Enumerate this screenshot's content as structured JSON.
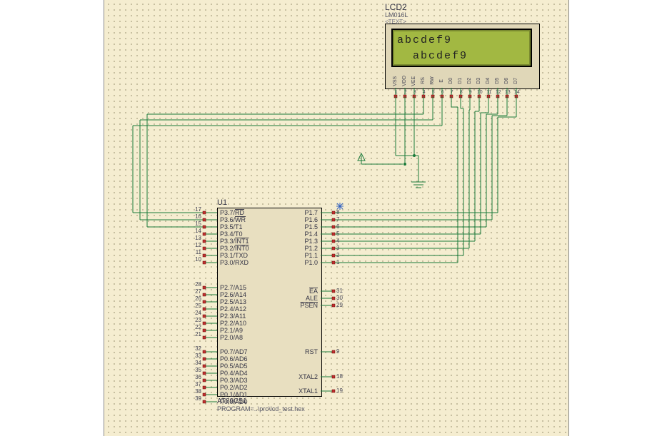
{
  "lcd": {
    "ref": "LCD2",
    "part": "LM016L",
    "textTag": "<TEXT>",
    "line1": "abcdef9",
    "line2": "  abcdef9",
    "pins": [
      "VSS",
      "VDD",
      "VEE",
      "RS",
      "RW",
      "E",
      "D0",
      "D1",
      "D2",
      "D3",
      "D4",
      "D5",
      "D6",
      "D7"
    ],
    "pinNums": [
      "1",
      "2",
      "3",
      "4",
      "5",
      "6",
      "7",
      "8",
      "9",
      "10",
      "11",
      "12",
      "13",
      "14"
    ]
  },
  "mcu": {
    "ref": "U1",
    "part": "AT89C51",
    "program": "PROGRAM=..\\pro\\lcd_test.hex",
    "leftPinsP3": [
      {
        "num": "17",
        "label": "P3.7/RD",
        "ol": true
      },
      {
        "num": "16",
        "label": "P3.6/WR",
        "ol": true
      },
      {
        "num": "15",
        "label": "P3.5/T1",
        "ol": false
      },
      {
        "num": "14",
        "label": "P3.4/T0",
        "ol": false
      },
      {
        "num": "13",
        "label": "P3.3/INT1",
        "ol": true
      },
      {
        "num": "12",
        "label": "P3.2/INT0",
        "ol": true
      },
      {
        "num": "11",
        "label": "P3.1/TXD",
        "ol": false
      },
      {
        "num": "10",
        "label": "P3.0/RXD",
        "ol": false
      }
    ],
    "leftPinsP2": [
      {
        "num": "28",
        "label": "P2.7/A15"
      },
      {
        "num": "27",
        "label": "P2.6/A14"
      },
      {
        "num": "26",
        "label": "P2.5/A13"
      },
      {
        "num": "25",
        "label": "P2.4/A12"
      },
      {
        "num": "24",
        "label": "P2.3/A11"
      },
      {
        "num": "23",
        "label": "P2.2/A10"
      },
      {
        "num": "22",
        "label": "P2.1/A9"
      },
      {
        "num": "21",
        "label": "P2.0/A8"
      }
    ],
    "leftPinsP0": [
      {
        "num": "32",
        "label": "P0.7/AD7"
      },
      {
        "num": "33",
        "label": "P0.6/AD6"
      },
      {
        "num": "34",
        "label": "P0.5/AD5"
      },
      {
        "num": "35",
        "label": "P0.4/AD4"
      },
      {
        "num": "36",
        "label": "P0.3/AD3"
      },
      {
        "num": "37",
        "label": "P0.2/AD2"
      },
      {
        "num": "38",
        "label": "P0.1/AD1"
      },
      {
        "num": "39",
        "label": "P0.0/AD0"
      }
    ],
    "rightPinsP1": [
      {
        "num": "8",
        "label": "P1.7"
      },
      {
        "num": "7",
        "label": "P1.6"
      },
      {
        "num": "6",
        "label": "P1.5"
      },
      {
        "num": "5",
        "label": "P1.4"
      },
      {
        "num": "4",
        "label": "P1.3"
      },
      {
        "num": "3",
        "label": "P1.2"
      },
      {
        "num": "2",
        "label": "P1.1"
      },
      {
        "num": "1",
        "label": "P1.0"
      }
    ],
    "rightPinsCtrl": [
      {
        "num": "31",
        "label": "EA",
        "ol": true
      },
      {
        "num": "30",
        "label": "ALE",
        "ol": false
      },
      {
        "num": "29",
        "label": "PSEN",
        "ol": true
      }
    ],
    "rst": {
      "num": "9",
      "label": "RST"
    },
    "xtal2": {
      "num": "18",
      "label": "XTAL2"
    },
    "xtal1": {
      "num": "19",
      "label": "XTAL1"
    }
  },
  "wires": {
    "color": "#1a7a3a"
  }
}
